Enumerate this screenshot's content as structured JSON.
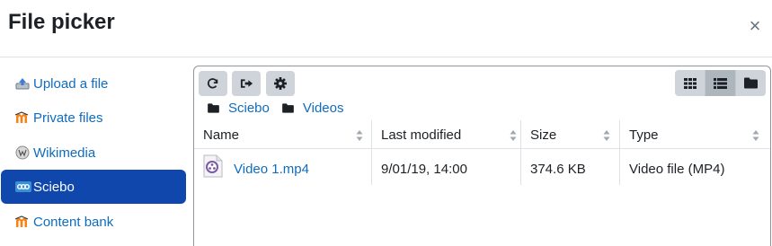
{
  "dialog": {
    "title": "File picker",
    "close_label": "×"
  },
  "repositories": [
    {
      "label": "Upload a file",
      "icon": "upload-icon",
      "active": false
    },
    {
      "label": "Private files",
      "icon": "moodle-icon",
      "active": false
    },
    {
      "label": "Wikimedia",
      "icon": "wikimedia-icon",
      "active": false
    },
    {
      "label": "Sciebo",
      "icon": "nextcloud-icon",
      "active": true
    },
    {
      "label": "Content bank",
      "icon": "moodle-icon",
      "active": false
    }
  ],
  "toolbar": {
    "refresh_icon": "refresh-icon",
    "logout_icon": "logout-icon",
    "settings_icon": "gear-icon"
  },
  "view_modes": [
    "icons",
    "list",
    "tree"
  ],
  "active_view": "list",
  "breadcrumb": [
    "Sciebo",
    "Videos"
  ],
  "table": {
    "columns": [
      "Name",
      "Last modified",
      "Size",
      "Type"
    ],
    "rows": [
      {
        "name": "Video 1.mp4",
        "modified": "9/01/19, 14:00",
        "size": "374.6 KB",
        "type": "Video file (MP4)"
      }
    ]
  },
  "colors": {
    "link": "#0f6cbf",
    "active_bg": "#0f47ad",
    "button_bg": "#ced4da"
  }
}
